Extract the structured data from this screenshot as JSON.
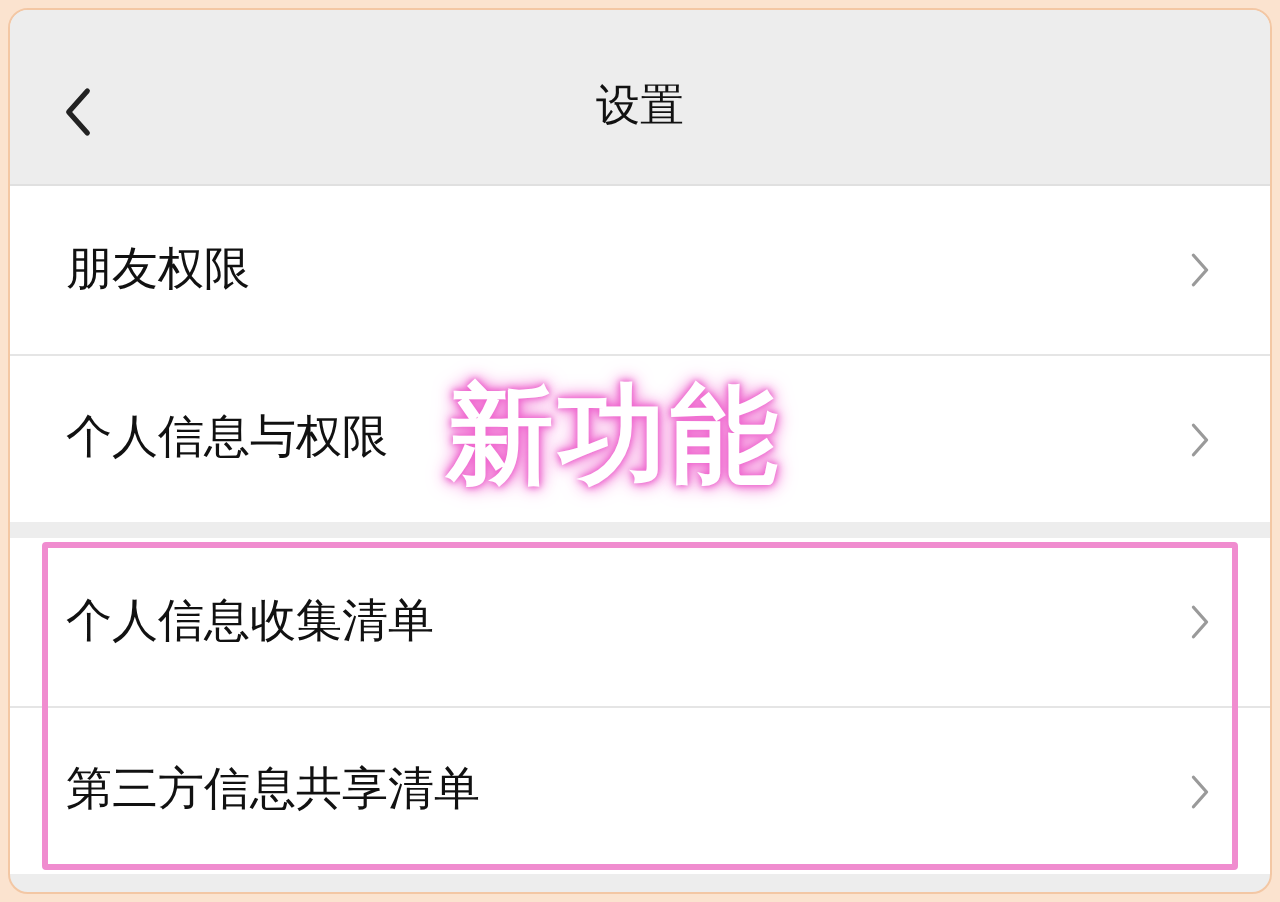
{
  "header": {
    "title": "设置"
  },
  "groups": [
    {
      "highlighted": false,
      "items": [
        {
          "label": "朋友权限"
        },
        {
          "label": "个人信息与权限"
        }
      ]
    },
    {
      "highlighted": true,
      "items": [
        {
          "label": "个人信息收集清单"
        },
        {
          "label": "第三方信息共享清单"
        }
      ]
    }
  ],
  "annotation": {
    "text": "新功能"
  }
}
